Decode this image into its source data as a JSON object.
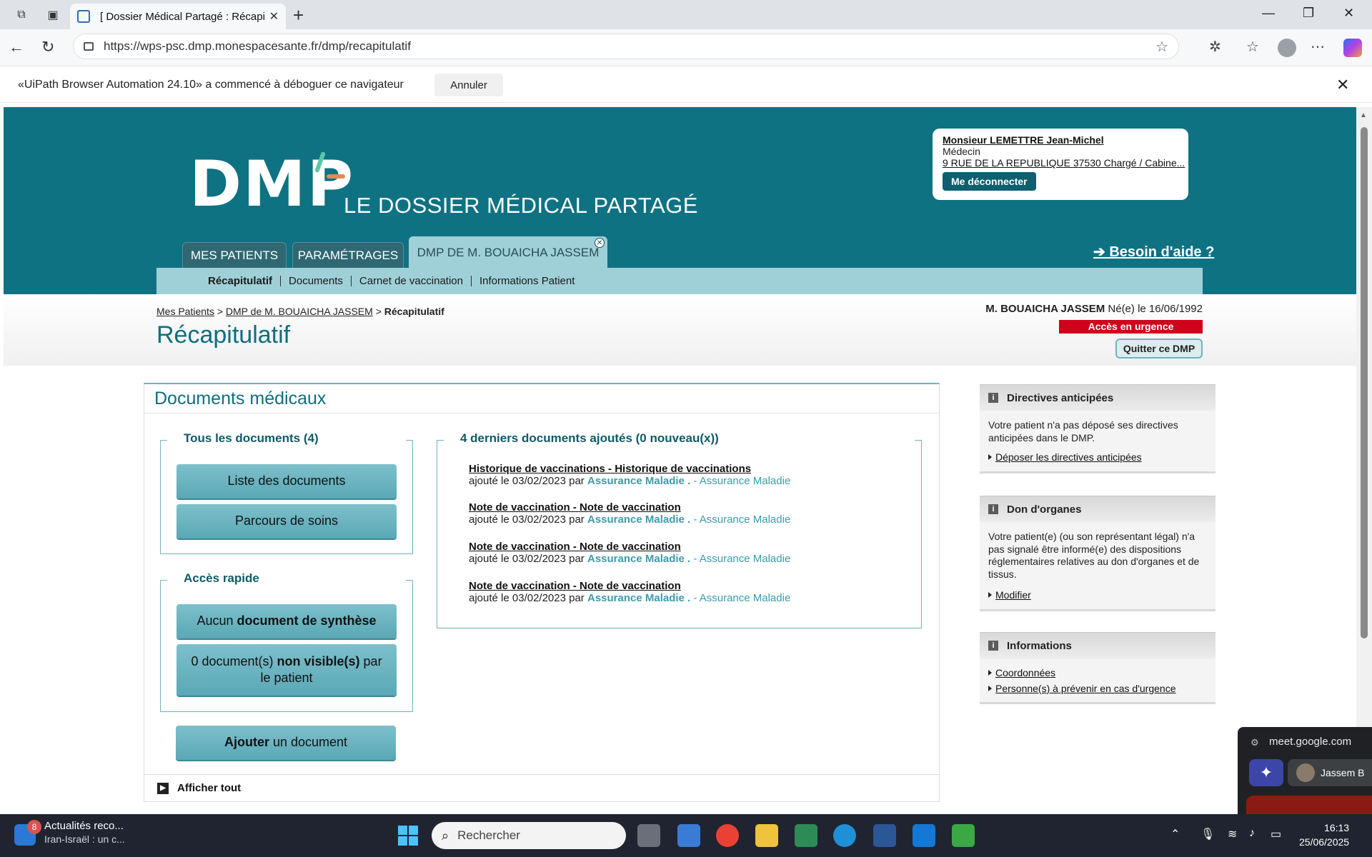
{
  "browser": {
    "tab_title": "[ Dossier Médical Partagé : Récapitulatif ]",
    "url_host": "https://wps-psc.dmp.monespacesante.fr",
    "url_path": "/dmp/recapitulatif",
    "infobar_message": "«UiPath Browser Automation 24.10» a commencé à déboguer ce navigateur",
    "infobar_cancel": "Annuler"
  },
  "header": {
    "logo_text": "DMP",
    "logo_subtitle": "LE DOSSIER MÉDICAL PARTAGÉ",
    "user": {
      "name": "Monsieur LEMETTRE Jean-Michel",
      "role": "Médecin",
      "address": "9 RUE DE LA REPUBLIQUE 37530 Chargé / Cabine...",
      "logout_label": "Me déconnecter"
    },
    "tabs": [
      {
        "label": "MES PATIENTS"
      },
      {
        "label": "PARAMÉTRAGES"
      },
      {
        "label": "DMP DE M. BOUAICHA JASSEM"
      }
    ],
    "help_label": "➔ Besoin d'aide ?",
    "subnav": [
      {
        "label": "Récapitulatif"
      },
      {
        "label": "Documents"
      },
      {
        "label": "Carnet de vaccination"
      },
      {
        "label": "Informations Patient"
      }
    ]
  },
  "titlebar": {
    "breadcrumb": [
      "Mes Patients",
      ">",
      "DMP de M. BOUAICHA JASSEM",
      ">",
      "Récapitulatif"
    ],
    "page_title": "Récapitulatif",
    "patient_name": "M. BOUAICHA JASSEM",
    "patient_born_label": "Né(e) le",
    "patient_dob": "16/06/1992",
    "urgency": "Accès en urgence",
    "quit_label": "Quitter ce DMP"
  },
  "docs": {
    "title": "Documents médicaux",
    "all_docs_title": "Tous les documents (4)",
    "list_button": "Liste des documents",
    "care_button": "Parcours de soins",
    "quick_title": "Accès rapide",
    "synth_prefix": "Aucun",
    "synth_bold": "document de synthèse",
    "hidden_prefix": "0 document(s)",
    "hidden_bold": "non visible(s)",
    "hidden_suffix": "par le patient",
    "add_bold": "Ajouter",
    "add_suffix": "un document",
    "recent_title": "4 derniers documents ajoutés (0 nouveau(x))",
    "recent": [
      {
        "title": "Historique de vaccinations - Historique de vaccinations",
        "meta": "ajouté le 03/02/2023 par",
        "author": "Assurance Maladie .",
        "org": "- Assurance Maladie"
      },
      {
        "title": "Note de vaccination - Note de vaccination",
        "meta": "ajouté le 03/02/2023 par",
        "author": "Assurance Maladie .",
        "org": "- Assurance Maladie"
      },
      {
        "title": "Note de vaccination - Note de vaccination",
        "meta": "ajouté le 03/02/2023 par",
        "author": "Assurance Maladie .",
        "org": "- Assurance Maladie"
      },
      {
        "title": "Note de vaccination - Note de vaccination",
        "meta": "ajouté le 03/02/2023 par",
        "author": "Assurance Maladie .",
        "org": "- Assurance Maladie"
      }
    ],
    "show_all": "Afficher tout"
  },
  "sidebar": {
    "directives": {
      "title": "Directives anticipées",
      "text": "Votre patient n'a pas déposé ses directives anticipées dans le DMP.",
      "link": "Déposer les directives anticipées"
    },
    "organs": {
      "title": "Don d'organes",
      "text": "Votre patient(e) (ou son représentant légal) n'a pas signalé être informé(e) des dispositions réglementaires relatives au don d'organes et de tissus.",
      "link": "Modifier"
    },
    "informations": {
      "title": "Informations",
      "links": [
        "Coordonnées",
        "Personne(s) à prévenir en cas d'urgence"
      ]
    }
  },
  "meet_popup": {
    "url": "meet.google.com",
    "person": "Jassem B"
  },
  "taskbar": {
    "news_badge": "8",
    "news_line1": "Actualités reco...",
    "news_line2": "Iran-Israël : un c...",
    "search_placeholder": "Rechercher",
    "time": "16:13",
    "date": "25/06/2025"
  },
  "colors": {
    "header_teal": "#0f7283",
    "subnav_light": "#9fd0d8",
    "urgency_red": "#d0021b",
    "accent_link": "#3c9bab"
  }
}
